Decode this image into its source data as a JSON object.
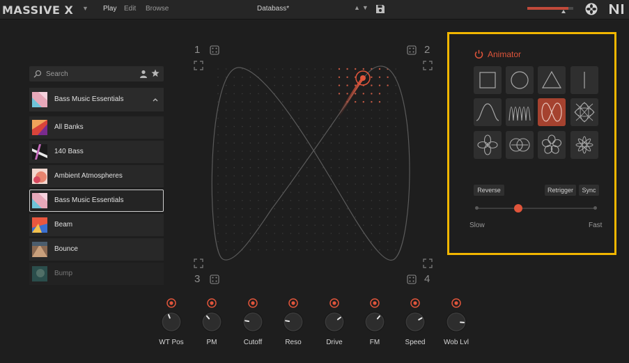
{
  "header": {
    "logo": "MASSIVE X",
    "menu": [
      "Play",
      "Edit",
      "Browse"
    ],
    "preset_name": "Databass*",
    "volume_level": 0.9,
    "colors": {
      "accent": "#e0553b",
      "highlight_frame": "#f2b600"
    }
  },
  "browser": {
    "search_placeholder": "Search",
    "bank_header": "Bass Music Essentials",
    "banks": [
      {
        "label": "All Banks"
      },
      {
        "label": "140 Bass"
      },
      {
        "label": "Ambient Atmospheres"
      },
      {
        "label": "Bass Music Essentials",
        "selected": true
      },
      {
        "label": "Beam"
      },
      {
        "label": "Bounce"
      },
      {
        "label": "Bump"
      }
    ]
  },
  "pad": {
    "corners": [
      "1",
      "2",
      "3",
      "4"
    ]
  },
  "animator": {
    "title": "Animator",
    "shapes": [
      "square",
      "circle",
      "triangle",
      "line",
      "sine",
      "zigzag",
      "figure-eight",
      "lissajous",
      "four-petal",
      "two-circles",
      "flower",
      "star"
    ],
    "active_shape": "figure-eight",
    "buttons": {
      "reverse": "Reverse",
      "retrigger": "Retrigger",
      "sync": "Sync"
    },
    "speed": {
      "min_label": "Slow",
      "max_label": "Fast",
      "value": 0.35
    }
  },
  "macros": [
    {
      "label": "WT Pos",
      "value": 0.42
    },
    {
      "label": "PM",
      "value": 0.35
    },
    {
      "label": "Cutoff",
      "value": 0.2
    },
    {
      "label": "Reso",
      "value": 0.2
    },
    {
      "label": "Drive",
      "value": 0.7
    },
    {
      "label": "FM",
      "value": 0.65
    },
    {
      "label": "Speed",
      "value": 0.72
    },
    {
      "label": "Wob Lvl",
      "value": 0.85
    }
  ]
}
